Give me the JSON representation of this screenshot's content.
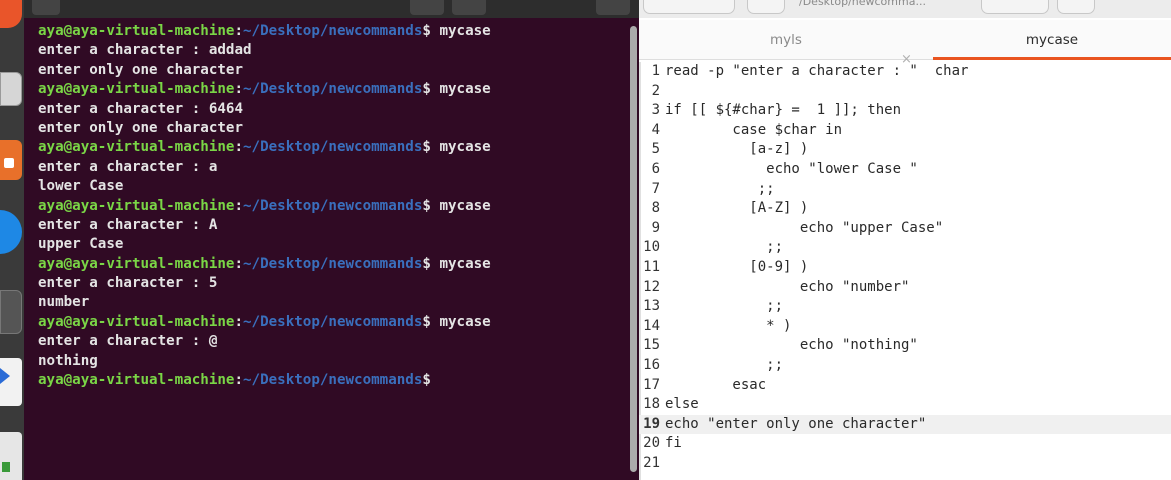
{
  "terminal": {
    "prompt_user": "aya@aya-virtual-machine",
    "prompt_path": "~/Desktop/newcommands",
    "lines": [
      {
        "kind": "prompt",
        "cmd": " mycase"
      },
      {
        "kind": "out",
        "text": "enter a character : addad"
      },
      {
        "kind": "out",
        "text": "enter only one character"
      },
      {
        "kind": "prompt",
        "cmd": " mycase"
      },
      {
        "kind": "out",
        "text": "enter a character : 6464"
      },
      {
        "kind": "out",
        "text": "enter only one character"
      },
      {
        "kind": "prompt",
        "cmd": " mycase"
      },
      {
        "kind": "out",
        "text": "enter a character : a"
      },
      {
        "kind": "out",
        "text": "lower Case"
      },
      {
        "kind": "prompt",
        "cmd": " mycase"
      },
      {
        "kind": "out",
        "text": "enter a character : A"
      },
      {
        "kind": "out",
        "text": "upper Case"
      },
      {
        "kind": "prompt",
        "cmd": " mycase"
      },
      {
        "kind": "out",
        "text": "enter a character : 5"
      },
      {
        "kind": "out",
        "text": "number"
      },
      {
        "kind": "prompt",
        "cmd": " mycase"
      },
      {
        "kind": "out",
        "text": "enter a character : @"
      },
      {
        "kind": "out",
        "text": "nothing"
      },
      {
        "kind": "prompt",
        "cmd": ""
      }
    ]
  },
  "editor": {
    "path": "/Desktop/newcomma...",
    "tabs": [
      {
        "label": "myls",
        "active": false
      },
      {
        "label": "mycase",
        "active": true
      }
    ],
    "close_glyph": "×",
    "current_line": 19,
    "lines": [
      "read -p \"enter a character : \"  char",
      "",
      "if [[ ${#char} =  1 ]]; then",
      "        case $char in",
      "          [a-z] )",
      "            echo \"lower Case \"",
      "           ;;",
      "          [A-Z] )",
      "                echo \"upper Case\"",
      "            ;;",
      "          [0-9] )",
      "                echo \"number\"",
      "            ;;",
      "            * )",
      "                echo \"nothing\"",
      "            ;;",
      "        esac",
      "else",
      "echo \"enter only one character\"",
      "fi",
      ""
    ]
  },
  "colors": {
    "terminal_bg": "#300a24",
    "prompt_user": "#7ad646",
    "prompt_path": "#3a6fbd",
    "tab_accent": "#e95420"
  },
  "dock": {
    "icons": [
      "firefox-icon",
      "files-icon",
      "software-store-icon",
      "help-icon",
      "terminal-icon",
      "text-editor-icon",
      "trash-icon"
    ]
  }
}
